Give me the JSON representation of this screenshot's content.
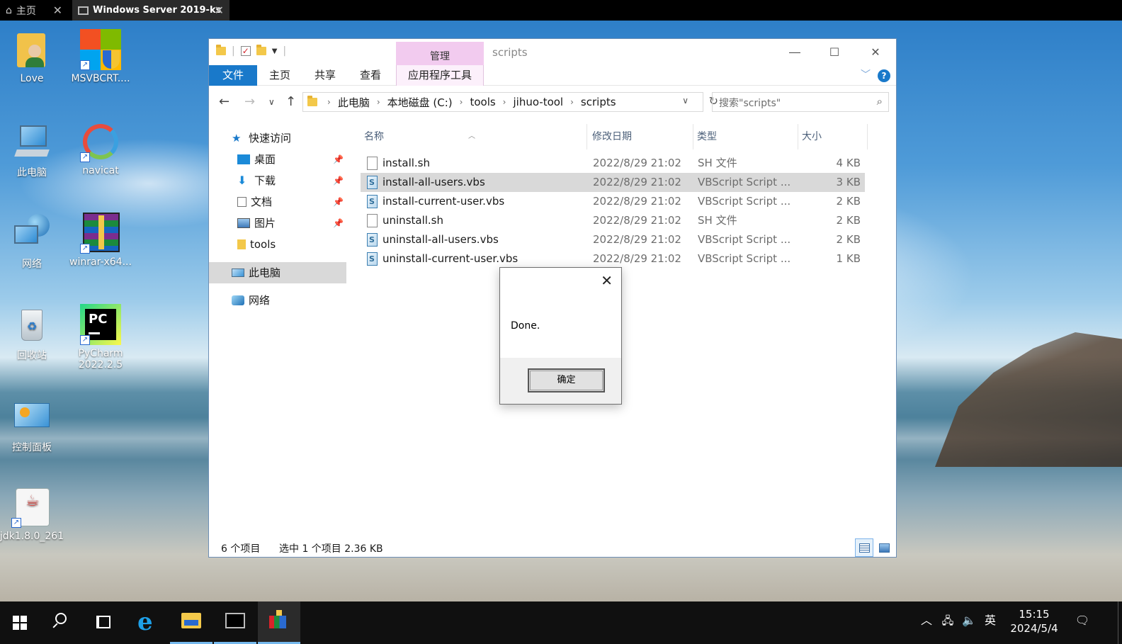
{
  "vm_tabs": {
    "home_label": "主页",
    "active_label": "Windows Server 2019-ks"
  },
  "desktop_icons": [
    {
      "label": "Love",
      "icon": "user-folder-icon"
    },
    {
      "label": "MSVBCRT....",
      "icon": "installer-shield-icon"
    },
    {
      "label": "此电脑",
      "icon": "computer-icon"
    },
    {
      "label": "navicat",
      "icon": "navicat-icon"
    },
    {
      "label": "网络",
      "icon": "network-icon"
    },
    {
      "label": "winrar-x64...",
      "icon": "winrar-icon"
    },
    {
      "label": "回收站",
      "icon": "recycle-bin-icon"
    },
    {
      "label": "PyCharm\n2022.2.5",
      "label_line1": "PyCharm",
      "label_line2": "2022.2.5",
      "icon": "pycharm-icon"
    },
    {
      "label": "控制面板",
      "icon": "control-panel-icon"
    },
    {
      "label": "jdk1.8.0_261",
      "icon": "java-icon"
    }
  ],
  "explorer": {
    "title": "scripts",
    "context_tab_group": "管理",
    "ribbon_tabs": [
      "文件",
      "主页",
      "共享",
      "查看",
      "应用程序工具"
    ],
    "address": {
      "crumbs": [
        "此电脑",
        "本地磁盘 (C:)",
        "tools",
        "jihuo-tool",
        "scripts"
      ]
    },
    "search_placeholder": "搜索\"scripts\"",
    "nav_pane": {
      "quick_access": "快速访问",
      "pinned": [
        "桌面",
        "下载",
        "文档",
        "图片"
      ],
      "recent": "tools",
      "this_pc": "此电脑",
      "network": "网络"
    },
    "columns": [
      "名称",
      "修改日期",
      "类型",
      "大小"
    ],
    "files": [
      {
        "name": "install.sh",
        "date": "2022/8/29 21:02",
        "type": "SH 文件",
        "size": "4 KB",
        "kind": "sh"
      },
      {
        "name": "install-all-users.vbs",
        "date": "2022/8/29 21:02",
        "type": "VBScript Script ...",
        "size": "3 KB",
        "kind": "vbs",
        "selected": true
      },
      {
        "name": "install-current-user.vbs",
        "date": "2022/8/29 21:02",
        "type": "VBScript Script ...",
        "size": "2 KB",
        "kind": "vbs"
      },
      {
        "name": "uninstall.sh",
        "date": "2022/8/29 21:02",
        "type": "SH 文件",
        "size": "2 KB",
        "kind": "sh"
      },
      {
        "name": "uninstall-all-users.vbs",
        "date": "2022/8/29 21:02",
        "type": "VBScript Script ...",
        "size": "2 KB",
        "kind": "vbs"
      },
      {
        "name": "uninstall-current-user.vbs",
        "date": "2022/8/29 21:02",
        "type": "VBScript Script ...",
        "size": "1 KB",
        "kind": "vbs"
      }
    ],
    "status": {
      "count": "6 个项目",
      "selection": "选中 1 个项目  2.36 KB"
    }
  },
  "message_box": {
    "message": "Done.",
    "ok_label": "确定"
  },
  "taskbar": {
    "ime": "英",
    "time": "15:15",
    "date": "2024/5/4"
  },
  "colors": {
    "ribbon_file_tab": "#1979ca",
    "context_tab": "#f2cbef",
    "selection": "#d9d9d9",
    "taskbar": "#101010"
  }
}
